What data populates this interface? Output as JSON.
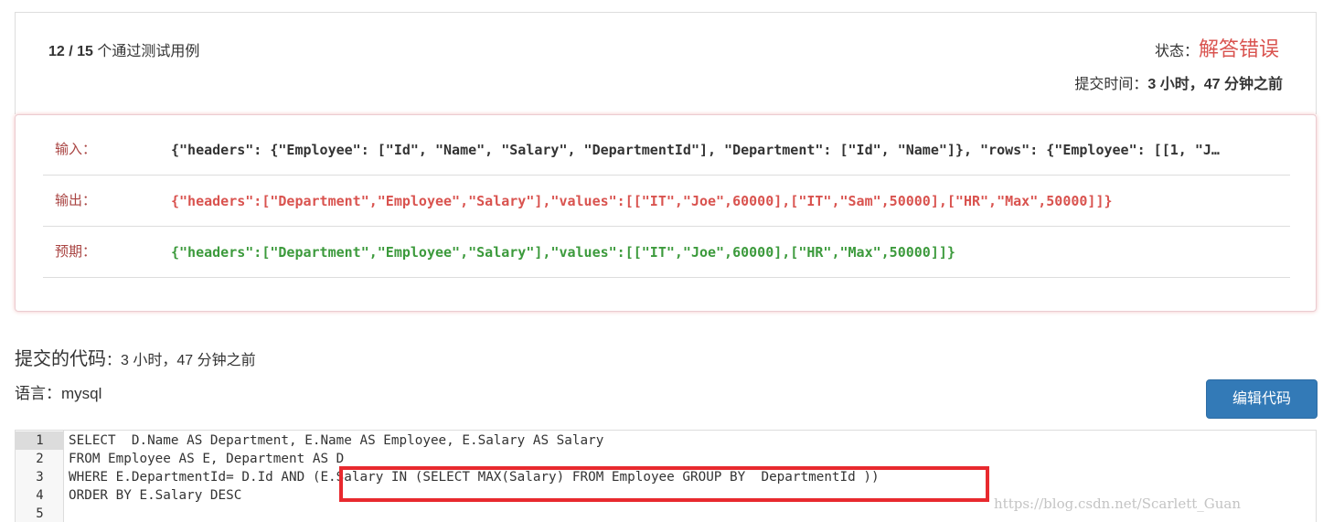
{
  "summary": {
    "passed": "12",
    "separator": " / ",
    "total": "15",
    "label": " 个通过测试用例",
    "status_label": "状态：",
    "status_value": "解答错误",
    "submit_time_label": "提交时间：",
    "submit_time_value": "3 小时，47 分钟之前",
    "status_color": "#d9534f"
  },
  "result": {
    "rows": [
      {
        "label": "输入：",
        "value": "{\"headers\": {\"Employee\": [\"Id\", \"Name\", \"Salary\", \"DepartmentId\"], \"Department\": [\"Id\", \"Name\"]}, \"rows\": {\"Employee\": [[1, \"J…"
      },
      {
        "label": "输出：",
        "value": "{\"headers\":[\"Department\",\"Employee\",\"Salary\"],\"values\":[[\"IT\",\"Joe\",60000],[\"IT\",\"Sam\",50000],[\"HR\",\"Max\",50000]]}"
      },
      {
        "label": "预期：",
        "value": "{\"headers\":[\"Department\",\"Employee\",\"Salary\"],\"values\":[[\"IT\",\"Joe\",60000],[\"HR\",\"Max\",50000]]}"
      }
    ],
    "output_color": "#d9534f",
    "expected_color": "#3c9a3c"
  },
  "code_section": {
    "title": "提交的代码",
    "time_suffix": "：3 小时，47 分钟之前",
    "language_label": "语言：",
    "language_value": "mysql",
    "edit_button_label": "编辑代码",
    "button_color": "#337ab7"
  },
  "editor": {
    "line_numbers": [
      "1",
      "2",
      "3",
      "4",
      "5"
    ],
    "lines": [
      "SELECT  D.Name AS Department, E.Name AS Employee, E.Salary AS Salary",
      "FROM Employee AS E, Department AS D",
      "WHERE E.DepartmentId= D.Id AND (E.Salary IN (SELECT MAX(Salary) FROM Employee GROUP BY  DepartmentId ))",
      "ORDER BY E.Salary DESC",
      ""
    ],
    "highlight_color": "#e8292e",
    "watermark": "https://blog.csdn.net/Scarlett_Guan"
  }
}
